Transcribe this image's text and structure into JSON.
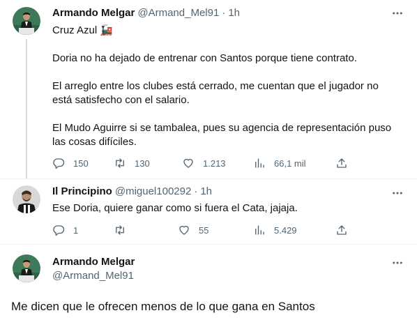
{
  "tweet1": {
    "name": "Armando Melgar",
    "handle": "@Armand_Mel91",
    "dot": "·",
    "time": "1h",
    "lines": [
      "Cruz Azul 🚂",
      "Doria no ha dejado de entrenar con Santos porque tiene contrato.",
      "El arreglo entre los clubes está cerrado, me cuentan que el jugador no",
      "está satisfecho con el salario.",
      "El Mudo Aguirre si se tambalea, pues su agencia de representación puso",
      "las cosas difíciles."
    ],
    "stats": {
      "replies": "150",
      "retweets": "130",
      "likes": "1.213",
      "views": "66,1 mil"
    }
  },
  "tweet2": {
    "name": "Il Principino",
    "handle": "@miguel100292",
    "dot": "·",
    "time": "1h",
    "text": "Ese Doria, quiere ganar como si fuera el Cata, jajaja.",
    "stats": {
      "replies": "1",
      "retweets": "",
      "likes": "55",
      "views": "5.429"
    }
  },
  "tweet3": {
    "name": "Armando Melgar",
    "handle": "@Armand_Mel91",
    "text": "Me dicen que le ofrecen menos de lo que gana en Santos"
  },
  "icons": [
    "more-icon",
    "reply-icon",
    "retweet-icon",
    "like-icon",
    "views-icon",
    "share-icon",
    "train-emoji"
  ],
  "colors": {
    "text": "#0f1419",
    "secondary": "#536471",
    "thread_line": "#cfd9de",
    "divider": "#eff3f4"
  }
}
